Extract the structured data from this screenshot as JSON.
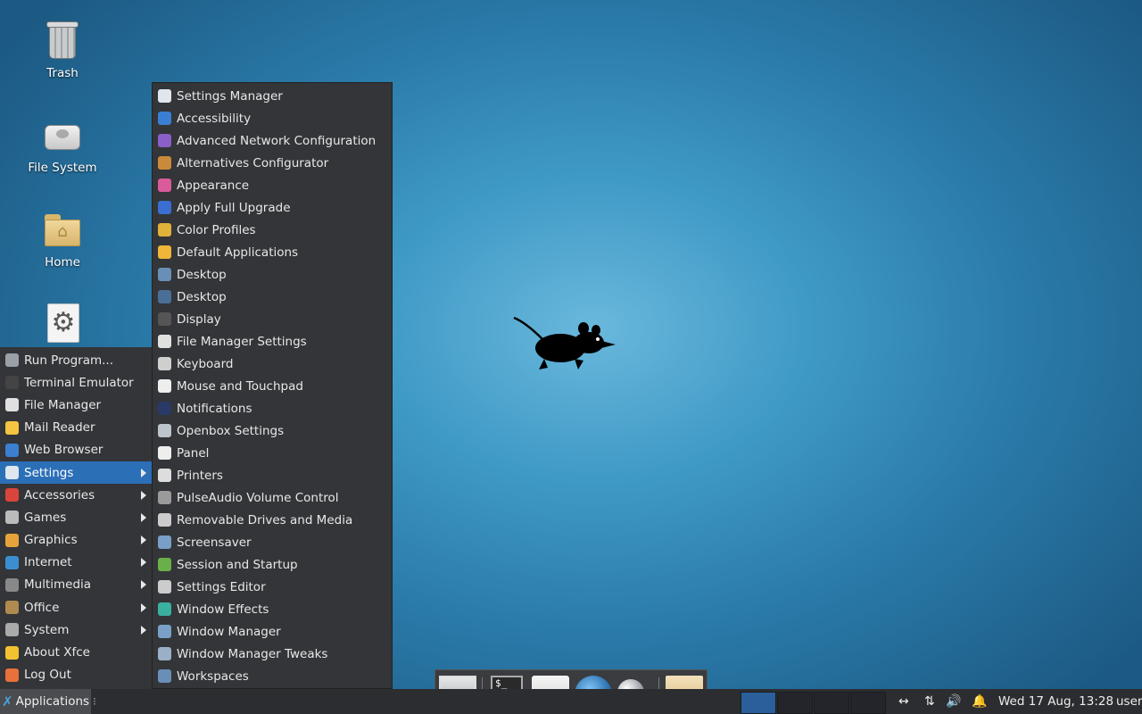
{
  "desktop": {
    "icons": [
      {
        "label": "Trash"
      },
      {
        "label": "File System"
      },
      {
        "label": "Home"
      }
    ]
  },
  "main_menu": {
    "items": [
      {
        "label": "Run Program...",
        "icon": "search-icon",
        "color": "#9aa0a6"
      },
      {
        "label": "Terminal Emulator",
        "icon": "terminal-icon",
        "color": "#444444"
      },
      {
        "label": "File Manager",
        "icon": "folder-icon",
        "color": "#e0e0e0"
      },
      {
        "label": "Mail Reader",
        "icon": "mail-icon",
        "color": "#f5c542"
      },
      {
        "label": "Web Browser",
        "icon": "globe-icon",
        "color": "#3b7fd1"
      },
      {
        "label": "Settings",
        "icon": "settings-icon",
        "color": "#dfe6ee",
        "submenu": true,
        "selected": true
      },
      {
        "label": "Accessories",
        "icon": "accessories-icon",
        "color": "#d9453b",
        "submenu": true
      },
      {
        "label": "Games",
        "icon": "games-icon",
        "color": "#bbbbbb",
        "submenu": true
      },
      {
        "label": "Graphics",
        "icon": "graphics-icon",
        "color": "#e7a33b",
        "submenu": true
      },
      {
        "label": "Internet",
        "icon": "internet-icon",
        "color": "#3b8fd1",
        "submenu": true
      },
      {
        "label": "Multimedia",
        "icon": "multimedia-icon",
        "color": "#888888",
        "submenu": true
      },
      {
        "label": "Office",
        "icon": "office-icon",
        "color": "#b08b4f",
        "submenu": true
      },
      {
        "label": "System",
        "icon": "system-icon",
        "color": "#aaaaaa",
        "submenu": true
      },
      {
        "label": "About Xfce",
        "icon": "star-icon",
        "color": "#f2c230"
      },
      {
        "label": "Log Out",
        "icon": "logout-icon",
        "color": "#e8703a"
      }
    ]
  },
  "settings_menu": {
    "items": [
      {
        "label": "Settings Manager",
        "icon": "settings-manager-icon",
        "color": "#dfe6ee"
      },
      {
        "label": "Accessibility",
        "icon": "accessibility-icon",
        "color": "#3a7fd1"
      },
      {
        "label": "Advanced Network Configuration",
        "icon": "network-icon",
        "color": "#8a5fc7"
      },
      {
        "label": "Alternatives Configurator",
        "icon": "alternatives-icon",
        "color": "#c98a3a"
      },
      {
        "label": "Appearance",
        "icon": "appearance-icon",
        "color": "#d95b9a"
      },
      {
        "label": "Apply Full Upgrade",
        "icon": "upgrade-icon",
        "color": "#3a6fd1"
      },
      {
        "label": "Color Profiles",
        "icon": "color-profiles-icon",
        "color": "#e0b23a"
      },
      {
        "label": "Default Applications",
        "icon": "default-apps-icon",
        "color": "#f0b63a"
      },
      {
        "label": "Desktop",
        "icon": "desktop-icon",
        "color": "#6a8fb7"
      },
      {
        "label": "Desktop",
        "icon": "desktop-icon",
        "color": "#4a6f97"
      },
      {
        "label": "Display",
        "icon": "display-icon",
        "color": "#555555"
      },
      {
        "label": "File Manager Settings",
        "icon": "folder-settings-icon",
        "color": "#e0e0e0"
      },
      {
        "label": "Keyboard",
        "icon": "keyboard-icon",
        "color": "#cfcfcf"
      },
      {
        "label": "Mouse and Touchpad",
        "icon": "mouse-icon",
        "color": "#eeeeee"
      },
      {
        "label": "Notifications",
        "icon": "notifications-icon",
        "color": "#2a3a66"
      },
      {
        "label": "Openbox Settings",
        "icon": "openbox-icon",
        "color": "#bcc4cc"
      },
      {
        "label": "Panel",
        "icon": "panel-icon",
        "color": "#eeeeee"
      },
      {
        "label": "Printers",
        "icon": "printer-icon",
        "color": "#dddddd"
      },
      {
        "label": "PulseAudio Volume Control",
        "icon": "volume-icon",
        "color": "#9a9a9a"
      },
      {
        "label": "Removable Drives and Media",
        "icon": "removable-drive-icon",
        "color": "#cccccc"
      },
      {
        "label": "Screensaver",
        "icon": "screensaver-icon",
        "color": "#7a9fc7"
      },
      {
        "label": "Session and Startup",
        "icon": "session-icon",
        "color": "#6ab04a"
      },
      {
        "label": "Settings Editor",
        "icon": "gear-icon",
        "color": "#cccccc"
      },
      {
        "label": "Window Effects",
        "icon": "window-effects-icon",
        "color": "#3ab0a0"
      },
      {
        "label": "Window Manager",
        "icon": "window-manager-icon",
        "color": "#7aa0c7"
      },
      {
        "label": "Window Manager Tweaks",
        "icon": "wm-tweaks-icon",
        "color": "#9ab0c7"
      },
      {
        "label": "Workspaces",
        "icon": "workspaces-icon",
        "color": "#6a8fb7"
      }
    ]
  },
  "dock": {
    "items": [
      {
        "icon": "show-desktop-icon"
      },
      {
        "icon": "terminal-icon",
        "glyph": "$_"
      },
      {
        "icon": "file-manager-icon"
      },
      {
        "icon": "web-browser-icon"
      },
      {
        "icon": "app-finder-icon"
      },
      {
        "icon": "folder-icon"
      }
    ]
  },
  "panel": {
    "applications_label": "Applications",
    "clock": "Wed 17 Aug, 13:28",
    "user": "user"
  }
}
